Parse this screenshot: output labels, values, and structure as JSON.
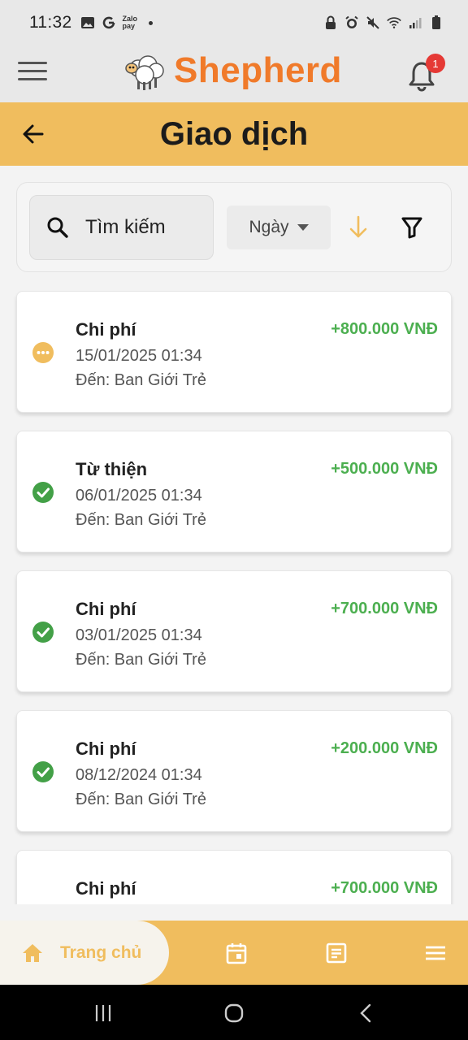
{
  "status_bar": {
    "time": "11:32",
    "left_icons": [
      "image-icon",
      "google-icon",
      "zalopay-icon",
      "dot-icon"
    ],
    "zalopay_text": "Zalo pay",
    "right_icons": [
      "lock-icon",
      "alarm-icon",
      "mute-icon",
      "wifi-icon",
      "signal-icon",
      "battery-icon"
    ]
  },
  "header": {
    "brand": "Shepherd",
    "notification_count": "1"
  },
  "title_bar": {
    "title": "Giao dịch"
  },
  "filters": {
    "search_placeholder": "Tìm kiếm",
    "sort_by": "Ngày",
    "sort_direction": "descending"
  },
  "transactions": [
    {
      "title": "Chi phí",
      "amount": "+800.000 VNĐ",
      "date": "15/01/2025 01:34",
      "to": "Đến: Ban Giới Trẻ",
      "status": "pending"
    },
    {
      "title": "Từ thiện",
      "amount": "+500.000 VNĐ",
      "date": "06/01/2025 01:34",
      "to": "Đến: Ban Giới Trẻ",
      "status": "completed"
    },
    {
      "title": "Chi phí",
      "amount": "+700.000 VNĐ",
      "date": "03/01/2025 01:34",
      "to": "Đến: Ban Giới Trẻ",
      "status": "completed"
    },
    {
      "title": "Chi phí",
      "amount": "+200.000 VNĐ",
      "date": "08/12/2024 01:34",
      "to": "Đến: Ban Giới Trẻ",
      "status": "completed"
    },
    {
      "title": "Chi phí",
      "amount": "+700.000 VNĐ",
      "date": "",
      "to": "",
      "status": "completed"
    }
  ],
  "bottom_nav": {
    "home_label": "Trang chủ",
    "items": [
      "home-icon",
      "calendar-icon",
      "notes-icon",
      "menu-icon"
    ]
  },
  "colors": {
    "accent": "#f0bd5e",
    "brand": "#f07a2a",
    "amount": "#4caf50",
    "pending": "#f0bd5e",
    "completed": "#43a047"
  }
}
